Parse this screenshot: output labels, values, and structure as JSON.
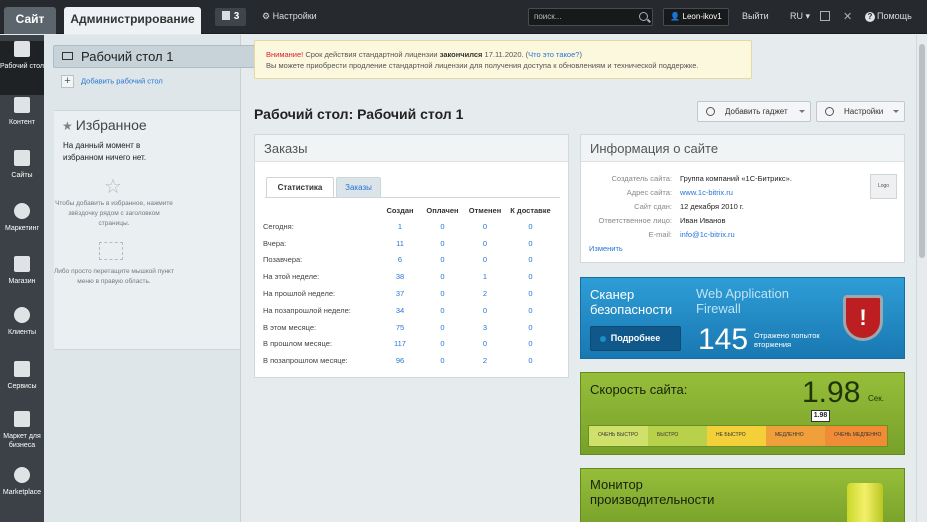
{
  "topbar": {
    "site_tab": "Сайт",
    "admin_tab": "Администрирование",
    "notifications_count": "3",
    "settings": "Настройки",
    "search_placeholder": "поиск...",
    "user": "Leon-ikov1",
    "logout": "Выйти",
    "lang": "RU",
    "help": "Помощь"
  },
  "sidebar": {
    "items": [
      {
        "label": "Рабочий стол",
        "icon": "home-icon"
      },
      {
        "label": "Контент",
        "icon": "document-icon"
      },
      {
        "label": "Сайты",
        "icon": "calendar-icon"
      },
      {
        "label": "Маркетинг",
        "icon": "target-icon"
      },
      {
        "label": "Магазин",
        "icon": "basket-icon"
      },
      {
        "label": "Клиенты",
        "icon": "clock-24-icon"
      },
      {
        "label": "Сервисы",
        "icon": "layers-icon"
      },
      {
        "label": "Маркет для бизнеса",
        "icon": "cart-icon"
      },
      {
        "label": "Marketplace",
        "icon": "cloud-download-icon"
      }
    ]
  },
  "left_panel": {
    "desktop_title": "Рабочий стол 1",
    "add_desktop": "Добавить рабочий стол",
    "favorites_title": "Избранное",
    "favorites_empty": "На данный момент в избранном ничего нет.",
    "favorites_hint1": "Чтобы добавить в избранное, нажмите звёздочку рядом с заголовком страницы.",
    "favorites_hint2": "Либо просто перетащите мышкой пункт меню в правую область."
  },
  "alert": {
    "warning": "Внимание!",
    "text1": " Срок действия стандартной лицензии ",
    "ended": "закончился",
    "text2": " 17.11.2020. (",
    "link": "Что это такое?",
    "text3": ")",
    "line2": "Вы можете приобрести продление стандартной лицензии для получения доступа к обновлениям и технической поддержке."
  },
  "page": {
    "title": "Рабочий стол: Рабочий стол 1",
    "add_gadget": "Добавить гаджет",
    "settings": "Настройки"
  },
  "orders": {
    "title": "Заказы",
    "tab_stats": "Статистика",
    "tab_orders": "Заказы",
    "columns": [
      "Создан",
      "Оплачен",
      "Отменен",
      "К доставке"
    ],
    "rows": [
      {
        "label": "Сегодня:",
        "v": [
          "1",
          "0",
          "0",
          "0"
        ]
      },
      {
        "label": "Вчера:",
        "v": [
          "11",
          "0",
          "0",
          "0"
        ]
      },
      {
        "label": "Позавчера:",
        "v": [
          "6",
          "0",
          "0",
          "0"
        ]
      },
      {
        "label": "На этой неделе:",
        "v": [
          "38",
          "0",
          "1",
          "0"
        ]
      },
      {
        "label": "На прошлой неделе:",
        "v": [
          "37",
          "0",
          "2",
          "0"
        ]
      },
      {
        "label": "На позапрошлой неделе:",
        "v": [
          "34",
          "0",
          "0",
          "0"
        ]
      },
      {
        "label": "В этом месяце:",
        "v": [
          "75",
          "0",
          "3",
          "0"
        ]
      },
      {
        "label": "В прошлом месяце:",
        "v": [
          "117",
          "0",
          "0",
          "0"
        ]
      },
      {
        "label": "В позапрошлом месяце:",
        "v": [
          "96",
          "0",
          "2",
          "0"
        ]
      }
    ]
  },
  "site_info": {
    "title": "Информация о сайте",
    "rows": [
      {
        "key": "Создатель сайта:",
        "value": "Группа компаний «1С-Битрикс»."
      },
      {
        "key": "Адрес сайта:",
        "value": "www.1c-bitrix.ru"
      },
      {
        "key": "Сайт сдан:",
        "value": "12 декабря 2010 г."
      },
      {
        "key": "Ответственное лицо:",
        "value": "Иван Иванов"
      },
      {
        "key": "E-mail:",
        "value": "info@1c-bitrix.ru"
      }
    ],
    "logo": "Logo",
    "edit": "Изменить"
  },
  "scanner": {
    "title": "Сканер безопасности",
    "waf": "Web Application Firewall",
    "button": "Подробнее",
    "count": "145",
    "count_label": "Отражено попыток вторжения"
  },
  "speed": {
    "title": "Скорость сайта:",
    "value": "1.98",
    "unit": "Сек.",
    "marker": "1.98",
    "segments": [
      "ОЧЕНЬ БЫСТРО",
      "БЫСТРО",
      "НЕ БЫСТРО",
      "МЕДЛЕННО",
      "ОЧЕНЬ МЕДЛЕННО"
    ],
    "colors": [
      "#cfe06b",
      "#b7d14a",
      "#f3cf3a",
      "#f0a03a",
      "#f08b36"
    ]
  },
  "monitor": {
    "title": "Монитор производительности"
  }
}
